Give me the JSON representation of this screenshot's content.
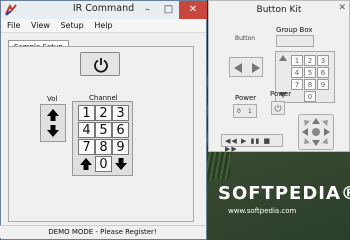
{
  "ir_window": {
    "title": "IR Command",
    "controls": {
      "minimize": "–",
      "maximize": "□",
      "close": "✕"
    },
    "menu": [
      "File",
      "View",
      "Setup",
      "Help"
    ],
    "tab": "Sample Setup",
    "power_icon": "power-icon",
    "vol_label": "Vol",
    "channel_label": "Channel",
    "keys": [
      "1",
      "2",
      "3",
      "4",
      "5",
      "6",
      "7",
      "8",
      "9",
      "0"
    ],
    "status": "DEMO MODE - Please Register!"
  },
  "button_kit": {
    "title": "Button Kit",
    "close": "✕",
    "button_label": "Button",
    "group_box_label": "Group Box",
    "power_label_1": "Power",
    "power_label_2": "Power",
    "toggle": [
      "0",
      "1"
    ],
    "keypad": [
      "1",
      "2",
      "3",
      "4",
      "5",
      "6",
      "7",
      "8",
      "9",
      "0"
    ],
    "media_controls": "◀◀ ▶ ▮▮ ■ ▶▶"
  },
  "watermark": {
    "logo": "SOFTPEDIA®",
    "url": "www.softpedia.com"
  }
}
